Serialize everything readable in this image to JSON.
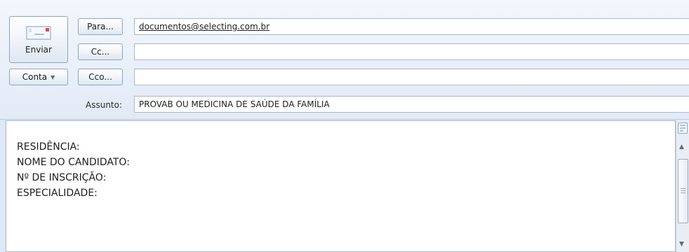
{
  "toolbar": {
    "send_label": "Enviar",
    "account_label": "Conta",
    "to_label": "Para...",
    "cc_label": "Cc...",
    "bcc_label": "Cco...",
    "subject_label": "Assunto:"
  },
  "fields": {
    "to": "documentos@selecting.com.br",
    "cc": "",
    "bcc": "",
    "subject": "PROVAB OU MEDICINA DE SAÚDE DA FAMÍLIA"
  },
  "body": {
    "lines": [
      "RESIDÊNCIA:",
      "NOME DO CANDIDATO:",
      "Nº DE INSCRIÇÃO:",
      "ESPECIALIDADE:"
    ]
  },
  "icons": {
    "send": "envelope-icon",
    "account_dropdown": "chevron-down-icon",
    "ruler": "ruler-toggle-icon",
    "scroll_up": "scroll-up-arrow-icon",
    "scroll_down": "scroll-down-arrow-icon"
  },
  "colors": {
    "header_bg": "#e2eaf6",
    "border": "#aab8cc",
    "button_border": "#8fa4c0"
  }
}
